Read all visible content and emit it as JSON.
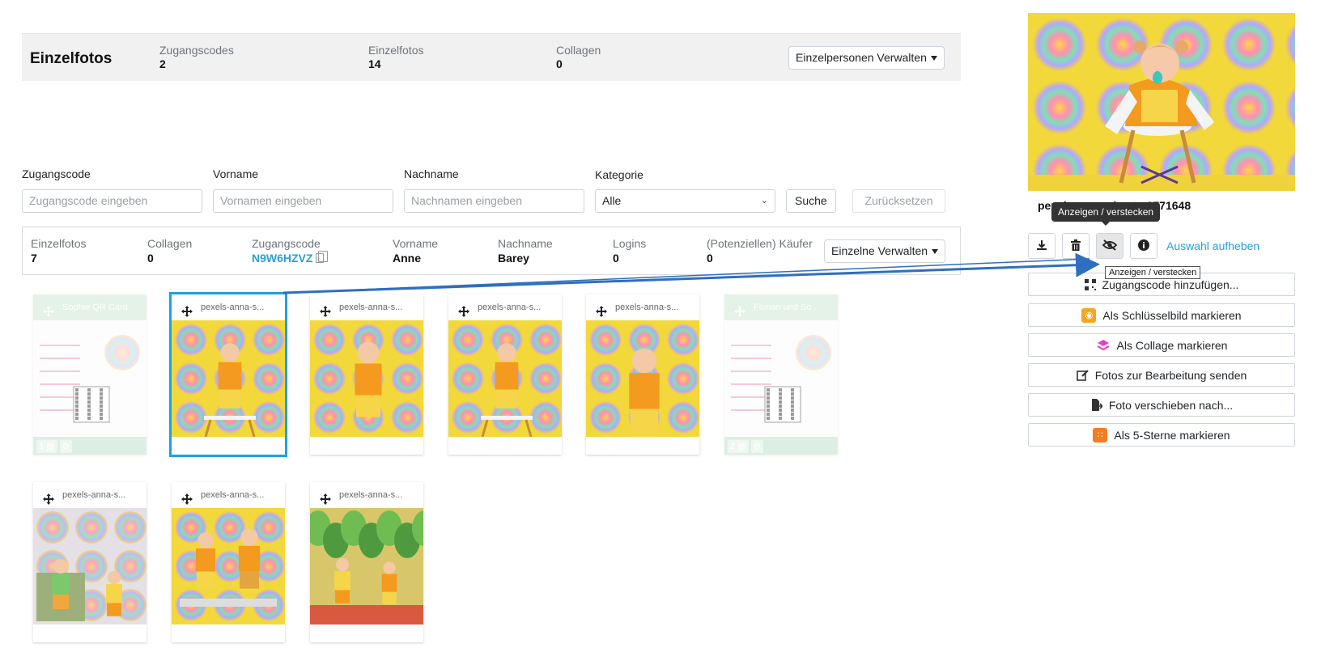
{
  "summary": {
    "title": "Einzelfotos",
    "stats": [
      {
        "label": "Zugangscodes",
        "value": "2"
      },
      {
        "label": "Einzelfotos",
        "value": "14"
      },
      {
        "label": "Collagen",
        "value": "0"
      }
    ],
    "manage_button": "Einzelpersonen Verwalten"
  },
  "filters": {
    "code_label": "Zugangscode",
    "code_placeholder": "Zugangscode eingeben",
    "first_label": "Vorname",
    "first_placeholder": "Vornamen eingeben",
    "last_label": "Nachname",
    "last_placeholder": "Nachnamen eingeben",
    "category_label": "Kategorie",
    "category_value": "Alle",
    "search_button": "Suche",
    "reset_button": "Zurücksetzen"
  },
  "person": {
    "stats": [
      {
        "label": "Einzelfotos",
        "value": "7"
      },
      {
        "label": "Collagen",
        "value": "0"
      },
      {
        "label": "Zugangscode",
        "value": "N9W6HZVZ"
      },
      {
        "label": "Vorname",
        "value": "Anne"
      },
      {
        "label": "Nachname",
        "value": "Barey"
      },
      {
        "label": "Logins",
        "value": "0"
      },
      {
        "label": "(Potenziellen) Käufer",
        "value": "0"
      }
    ],
    "manage_button": "Einzelne Verwalten"
  },
  "photos": [
    {
      "name": "Sophie QR Card",
      "type": "qr",
      "hidden": true,
      "badge": "1"
    },
    {
      "name": "pexels-anna-s...",
      "type": "child-chair",
      "selected": true
    },
    {
      "name": "pexels-anna-s...",
      "type": "child-close"
    },
    {
      "name": "pexels-anna-s...",
      "type": "child-stool"
    },
    {
      "name": "pexels-anna-s...",
      "type": "child-face"
    },
    {
      "name": "Florian und So...",
      "type": "qr",
      "hidden": true,
      "badge": "2"
    },
    {
      "name": "pexels-anna-s...",
      "type": "two-chairs"
    },
    {
      "name": "pexels-anna-s...",
      "type": "two-sitting"
    },
    {
      "name": "pexels-anna-s...",
      "type": "plants"
    }
  ],
  "panel": {
    "filename": "pexels-anna-shvets-3771648",
    "tooltip_dark": "Anzeigen / verstecken",
    "tooltip_light": "Anzeigen / verstecken",
    "deselect": "Auswahl aufheben",
    "actions": [
      {
        "label": "Zugangscode hinzufügen...",
        "icon": "qr-icon",
        "color": "#333333"
      },
      {
        "label": "Als Schlüsselbild markieren",
        "icon": "key-image-icon",
        "color": "#f5a623"
      },
      {
        "label": "Als Collage markieren",
        "icon": "layers-icon",
        "color": "#e040c8"
      },
      {
        "label": "Fotos zur Bearbeitung senden",
        "icon": "edit-icon",
        "color": "#333333"
      },
      {
        "label": "Foto verschieben nach...",
        "icon": "file-move-icon",
        "color": "#333333"
      },
      {
        "label": "Als 5-Sterne markieren",
        "icon": "stars-icon",
        "color": "#f57c1f"
      }
    ]
  },
  "colors": {
    "accent": "#2a9fd6",
    "selected_border": "#1fa2de",
    "arrow": "#2f6fbf",
    "hidden_card": "#c4e3cb"
  }
}
